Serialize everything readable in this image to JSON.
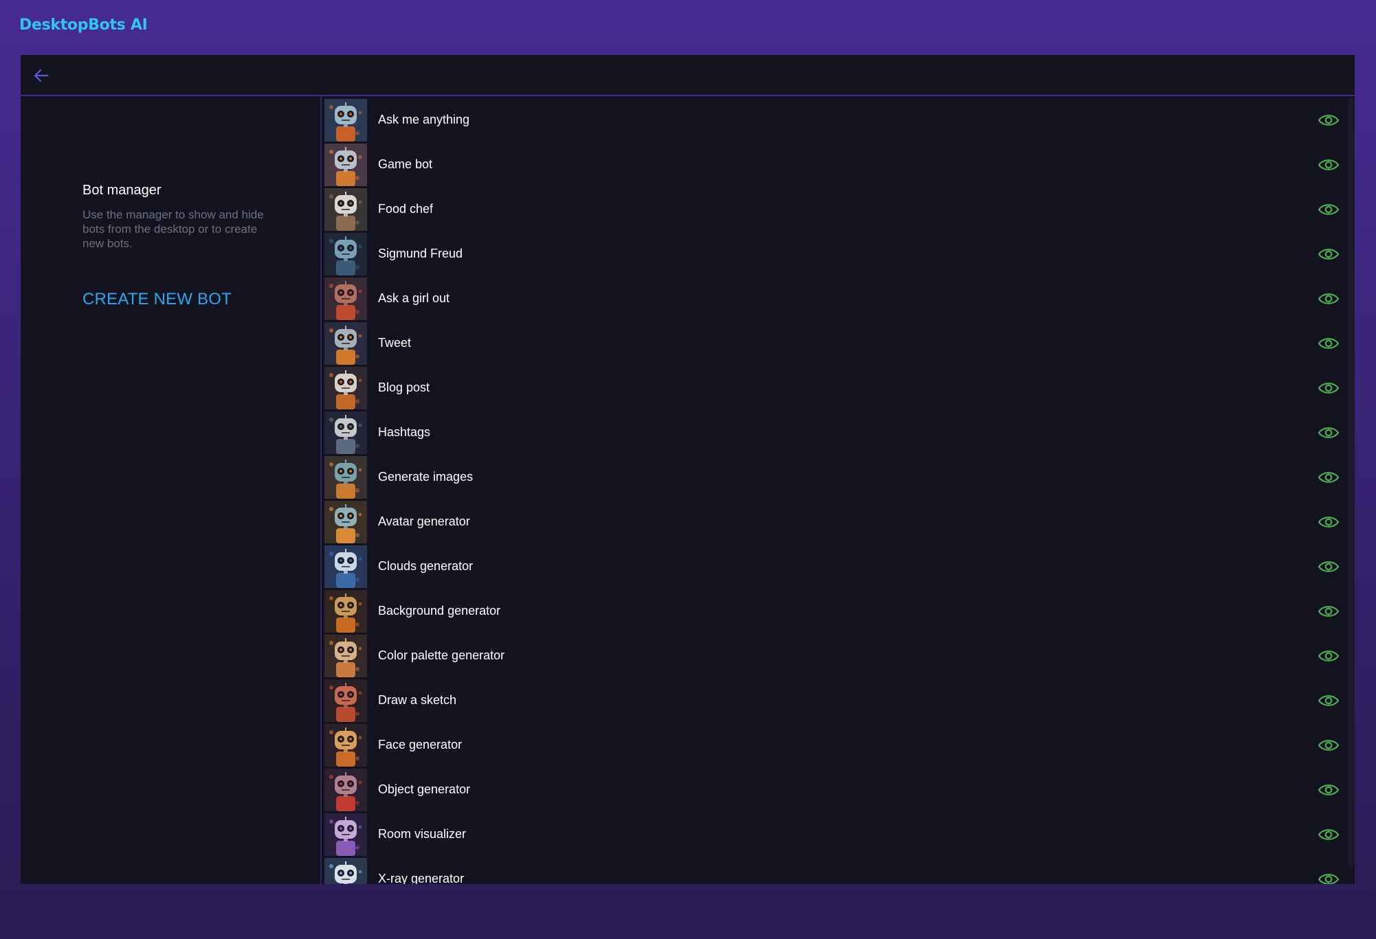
{
  "app": {
    "title": "DesktopBots AI"
  },
  "topbar": {
    "back_icon": "arrow-left-icon",
    "accent": "#5a57e0"
  },
  "sidebar": {
    "title": "Bot manager",
    "description": "Use the manager to show and hide bots from the desktop or to create new bots.",
    "create_label": "CREATE NEW BOT"
  },
  "colors": {
    "background": "#472b91",
    "panel": "#13131f",
    "brand": "#2ec4f5",
    "create": "#2aa8ef",
    "eye": "#4caf50"
  },
  "bots": [
    {
      "name": "Ask me anything",
      "visibility_icon": "eye-icon",
      "palette": [
        "#9fb8c8",
        "#c8602a",
        "#2a3a55"
      ]
    },
    {
      "name": "Game bot",
      "visibility_icon": "eye-icon",
      "palette": [
        "#b8c0c8",
        "#d07a30",
        "#4a3a45"
      ]
    },
    {
      "name": "Food chef",
      "visibility_icon": "eye-icon",
      "palette": [
        "#d8d8d0",
        "#8a6a50",
        "#3a3535"
      ]
    },
    {
      "name": "Sigmund Freud",
      "visibility_icon": "eye-icon",
      "palette": [
        "#7aa0b8",
        "#3a5a78",
        "#202838"
      ]
    },
    {
      "name": "Ask a girl out",
      "visibility_icon": "eye-icon",
      "palette": [
        "#b07060",
        "#c04a30",
        "#3a2a35"
      ]
    },
    {
      "name": "Tweet",
      "visibility_icon": "eye-icon",
      "palette": [
        "#a8b0b8",
        "#d07828",
        "#2a2a40"
      ]
    },
    {
      "name": "Blog post",
      "visibility_icon": "eye-icon",
      "palette": [
        "#d8d0c8",
        "#c06828",
        "#302830"
      ]
    },
    {
      "name": "Hashtags",
      "visibility_icon": "eye-icon",
      "palette": [
        "#c8c8c8",
        "#5a6a80",
        "#25253a"
      ]
    },
    {
      "name": "Generate images",
      "visibility_icon": "eye-icon",
      "palette": [
        "#7aa0a8",
        "#c87a30",
        "#3a3030"
      ]
    },
    {
      "name": "Avatar generator",
      "visibility_icon": "eye-icon",
      "palette": [
        "#90b0b8",
        "#d88a38",
        "#3a3028"
      ]
    },
    {
      "name": "Clouds generator",
      "visibility_icon": "eye-icon",
      "palette": [
        "#c8d8e8",
        "#3a6aa8",
        "#28385a"
      ]
    },
    {
      "name": "Background generator",
      "visibility_icon": "eye-icon",
      "palette": [
        "#c89a58",
        "#c86a20",
        "#302520"
      ]
    },
    {
      "name": "Color palette generator",
      "visibility_icon": "eye-icon",
      "palette": [
        "#d8b088",
        "#c87a40",
        "#352a25"
      ]
    },
    {
      "name": "Draw a sketch",
      "visibility_icon": "eye-icon",
      "palette": [
        "#c86a50",
        "#b84a30",
        "#2a2025"
      ]
    },
    {
      "name": "Face generator",
      "visibility_icon": "eye-icon",
      "palette": [
        "#d8a058",
        "#c86a28",
        "#2a2028"
      ]
    },
    {
      "name": "Object generator",
      "visibility_icon": "eye-icon",
      "palette": [
        "#b08090",
        "#c03a30",
        "#2a2030"
      ]
    },
    {
      "name": "Room visualizer",
      "visibility_icon": "eye-icon",
      "palette": [
        "#c8a8d8",
        "#8a5ab8",
        "#2a2040"
      ]
    },
    {
      "name": "X-ray generator",
      "visibility_icon": "eye-icon",
      "palette": [
        "#d8e0e8",
        "#7aa8d8",
        "#2a3850"
      ]
    }
  ]
}
